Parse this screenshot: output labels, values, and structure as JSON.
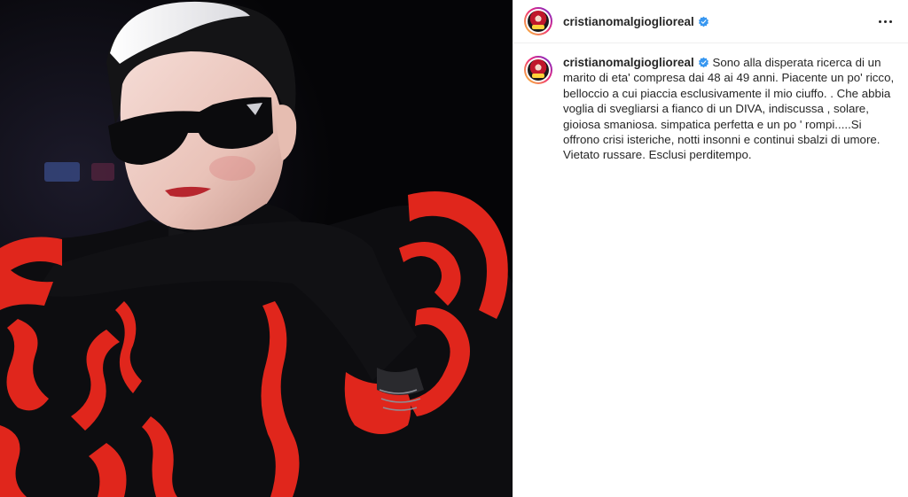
{
  "post": {
    "author": {
      "username": "cristianomalgioglioreal",
      "verified": true,
      "avatar": "profile-avatar"
    },
    "header": {
      "more_icon": "more-options-icon"
    },
    "caption": {
      "username": "cristianomalgioglioreal",
      "text": "Sono alla disperata ricerca di un marito di eta' compresa dai 48 ai 49 anni. Piacente un po' ricco, belloccio a cui piaccia esclusivamente il mio ciuffo. . Che abbia voglia di svegliarsi a fianco di un DIVA, indiscussa , solare, gioiosa smaniosa. simpatica perfetta e un po ' rompi.....Si offrono crisi isteriche, notti insonni e continui sbalzi di umore. Vietato russare. Esclusi perditempo."
    },
    "image": {
      "description_icon": "post-photo"
    },
    "colors": {
      "verified": "#3897f0",
      "accent_red": "#e0261c",
      "background_dark": "#050507"
    }
  }
}
